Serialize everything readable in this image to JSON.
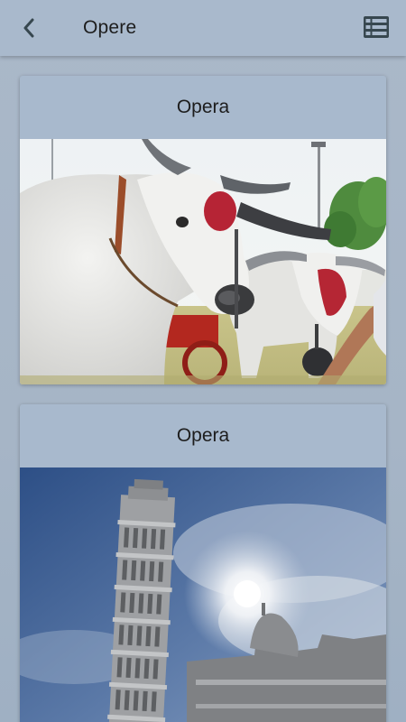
{
  "header": {
    "title": "Opere",
    "back_icon": "chevron-left-icon",
    "menu_icon": "view-list-icon"
  },
  "cards": [
    {
      "title": "Opera",
      "image_subject": "oxen-photo"
    },
    {
      "title": "Opera",
      "image_subject": "leaning-tower-photo"
    }
  ],
  "colors": {
    "app_bar": "#a9b9cc",
    "card": "#a8b9cd",
    "text": "#1d1d1d",
    "icon": "#37474f"
  }
}
